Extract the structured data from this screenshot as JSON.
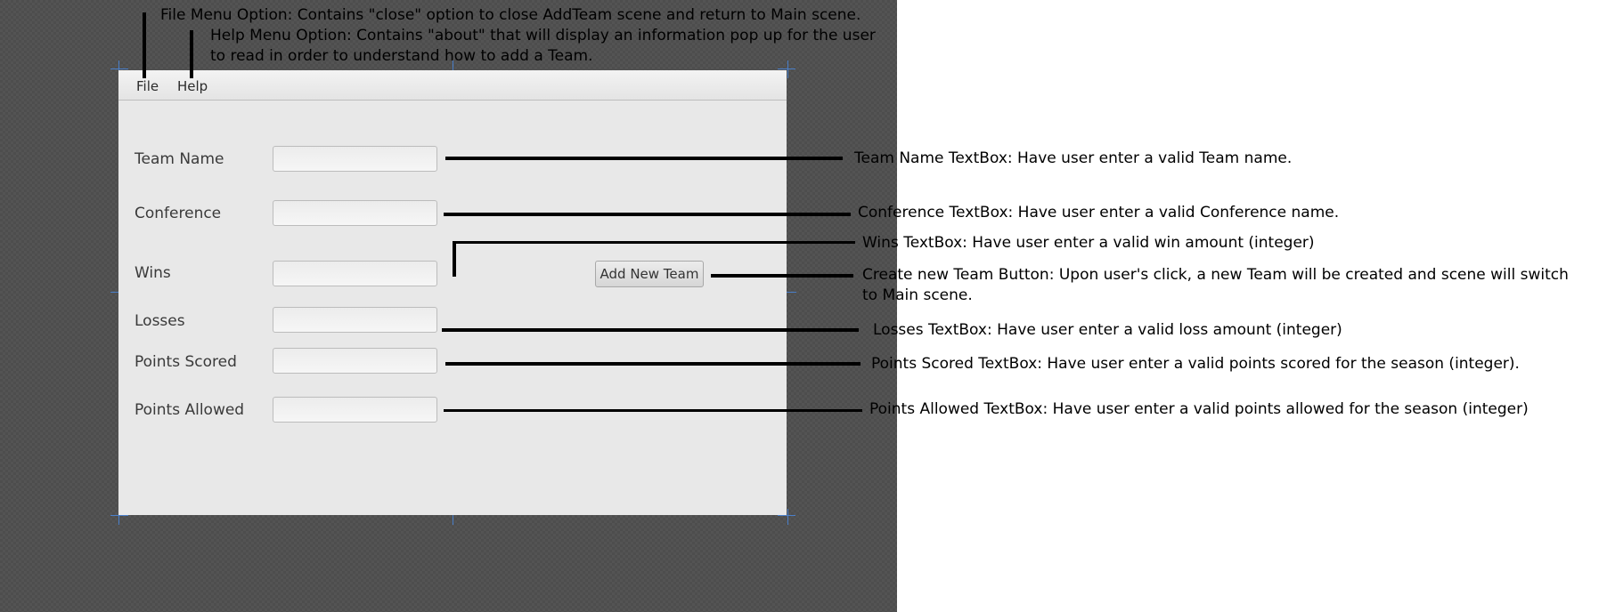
{
  "menu": {
    "file": "File",
    "help": "Help"
  },
  "form": {
    "team_name_label": "Team Name",
    "conference_label": "Conference",
    "wins_label": "Wins",
    "losses_label": "Losses",
    "points_scored_label": "Points Scored",
    "points_allowed_label": "Points Allowed",
    "add_button_label": "Add New Team",
    "team_name_value": "",
    "conference_value": "",
    "wins_value": "",
    "losses_value": "",
    "points_scored_value": "",
    "points_allowed_value": ""
  },
  "annotations": {
    "file_menu": "File Menu Option: Contains \"close\" option to close AddTeam scene and return to Main scene.",
    "help_menu": "Help Menu Option: Contains \"about\" that will display an information pop up for the user to read in order to understand how to add a Team.",
    "team_name": "Team Name TextBox: Have user enter a valid Team name.",
    "conference": "Conference TextBox: Have user enter a valid Conference name.",
    "wins": "Wins TextBox: Have user enter a valid win amount (integer)",
    "add_button": "Create new Team Button: Upon user's click, a new Team will be created and scene will switch to Main scene.",
    "losses": "Losses TextBox: Have user enter a valid loss amount (integer)",
    "points_scored": "Points Scored TextBox: Have user enter a valid points scored for the season (integer).",
    "points_allowed": "Points Allowed TextBox: Have user enter a valid points allowed for the season (integer)"
  },
  "colors": {
    "canvas_background": "#4d4d4d",
    "window_background": "#e8e8e8",
    "guide_marks": "#4a7fc9",
    "callout_lines": "#000000"
  }
}
